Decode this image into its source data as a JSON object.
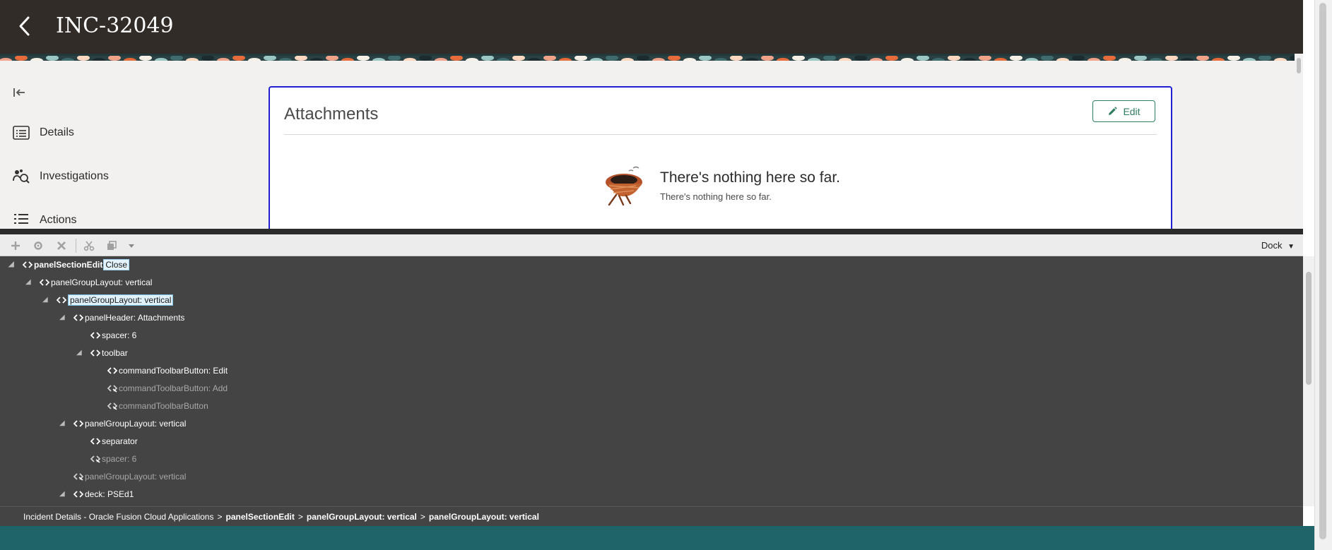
{
  "header": {
    "title": "INC-32049"
  },
  "nav": {
    "items": [
      {
        "label": "Details",
        "icon": "details-list-icon"
      },
      {
        "label": "Investigations",
        "icon": "investigations-icon"
      },
      {
        "label": "Actions",
        "icon": "actions-icon"
      }
    ]
  },
  "card": {
    "title": "Attachments",
    "edit_label": "Edit",
    "empty_title": "There's nothing here so far.",
    "empty_sub": "There's nothing here so far."
  },
  "inspector": {
    "dock_label": "Dock",
    "tree": [
      {
        "label": "panelSectionEdit",
        "suffix": "Close",
        "level": 0,
        "state": "expanded",
        "style": "bold"
      },
      {
        "label": "panelGroupLayout: vertical",
        "level": 1,
        "state": "expanded",
        "style": "normal"
      },
      {
        "label": "panelGroupLayout: vertical",
        "level": 2,
        "state": "expanded",
        "style": "selected"
      },
      {
        "label": "panelHeader: Attachments",
        "level": 3,
        "state": "expanded",
        "style": "normal"
      },
      {
        "label": "spacer: 6",
        "level": 4,
        "state": "leaf",
        "style": "normal"
      },
      {
        "label": "toolbar",
        "level": 4,
        "state": "expanded",
        "style": "normal"
      },
      {
        "label": "commandToolbarButton: Edit",
        "level": 5,
        "state": "leaf",
        "style": "normal"
      },
      {
        "label": "commandToolbarButton: Add",
        "level": 5,
        "state": "leaf",
        "style": "dim"
      },
      {
        "label": "commandToolbarButton",
        "level": 5,
        "state": "leaf",
        "style": "dim"
      },
      {
        "label": "panelGroupLayout: vertical",
        "level": 3,
        "state": "expanded",
        "style": "normal"
      },
      {
        "label": "separator",
        "level": 4,
        "state": "leaf",
        "style": "normal"
      },
      {
        "label": "spacer: 6",
        "level": 4,
        "state": "leaf",
        "style": "dim"
      },
      {
        "label": "panelGroupLayout: vertical",
        "level": 3,
        "state": "leaf",
        "style": "dim"
      },
      {
        "label": "deck: PSEd1",
        "level": 3,
        "state": "expanded",
        "style": "normal"
      }
    ],
    "breadcrumb": {
      "root": "Incident Details - Oracle Fusion Cloud Applications",
      "items": [
        "panelSectionEdit",
        "panelGroupLayout: vertical",
        "panelGroupLayout: vertical"
      ],
      "separator": ">"
    }
  },
  "colors": {
    "header_bg": "#322c29",
    "accent_green": "#2e7d5e",
    "card_border": "#2020d0",
    "inspector_bg": "#444444",
    "footer_band": "#1f6468"
  }
}
